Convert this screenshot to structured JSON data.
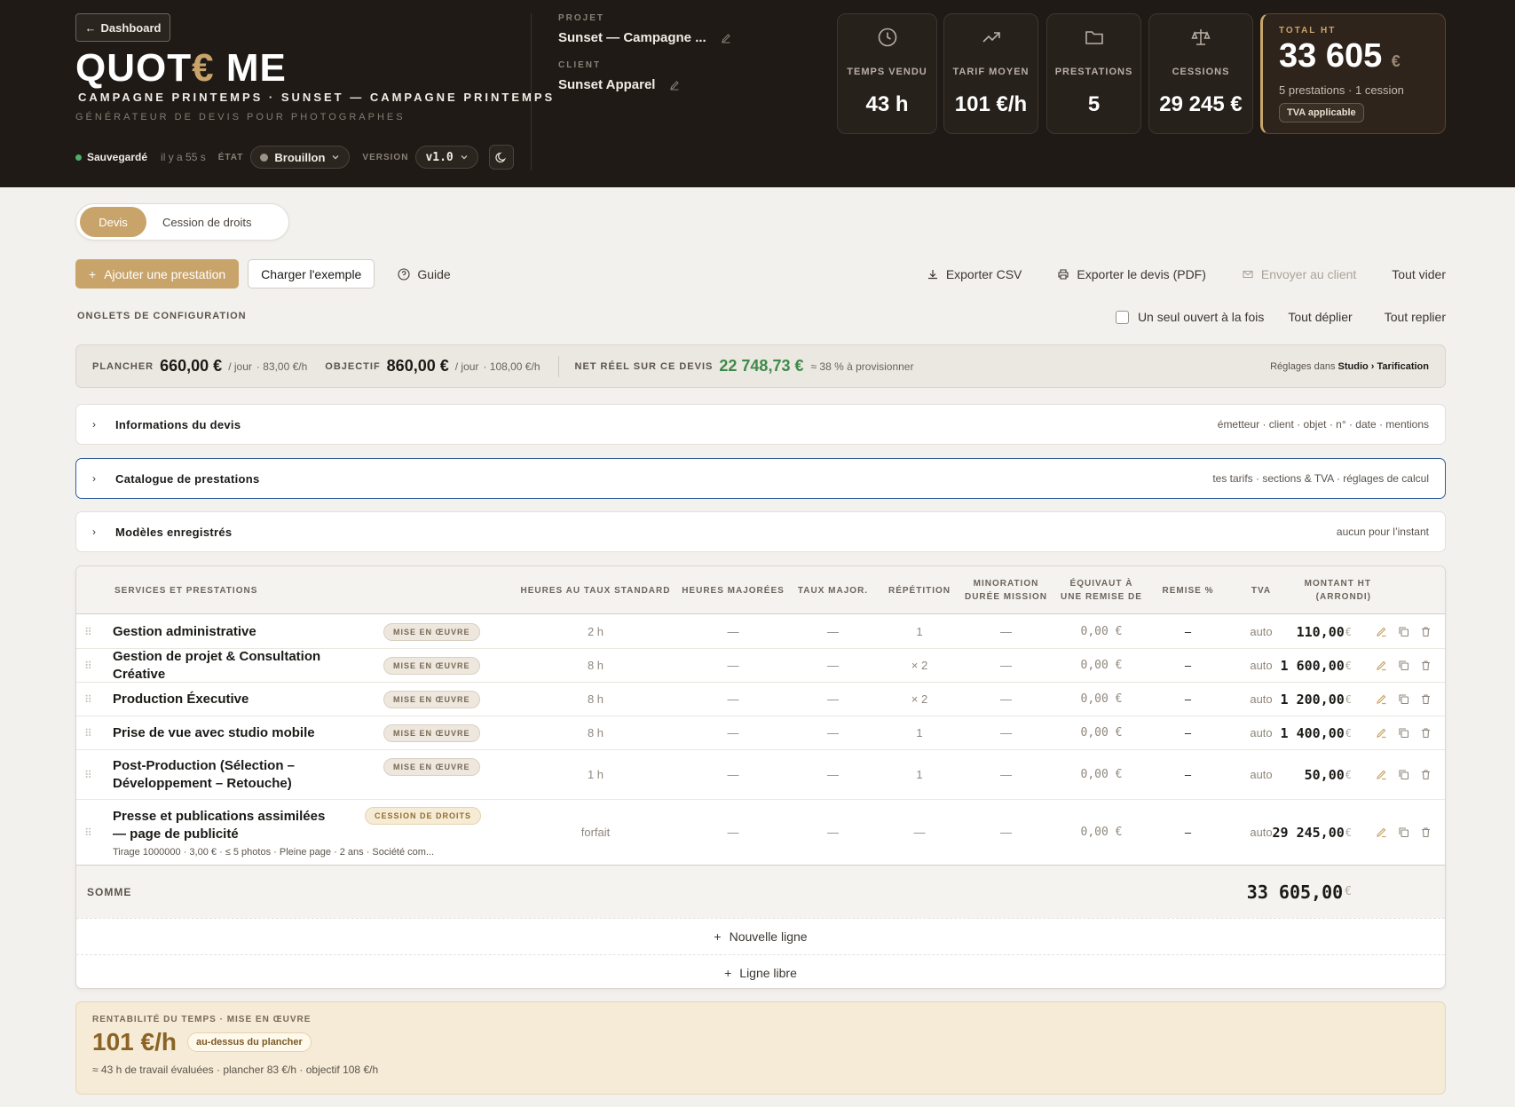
{
  "header": {
    "back_label": "Dashboard",
    "logo_left": "QUOT",
    "logo_euro": "€",
    "logo_right": "ME",
    "subtitle": "CAMPAGNE PRINTEMPS · SUNSET — CAMPAGNE PRINTEMPS",
    "tagline": "GÉNÉRATEUR DE DEVIS POUR PHOTOGRAPHES",
    "saved_label": "Sauvegardé",
    "saved_ago": "il y a 55 s",
    "state_label": "ÉTAT",
    "state_value": "Brouillon",
    "version_label": "VERSION",
    "version_value": "v1.0",
    "project_label": "PROJET",
    "project_value": "Sunset — Campagne ...",
    "client_label": "CLIENT",
    "client_value": "Sunset Apparel"
  },
  "kpis": [
    {
      "label": "TEMPS VENDU",
      "value": "43 h",
      "icon": "clock-icon"
    },
    {
      "label": "TARIF MOYEN",
      "value": "101 €/h",
      "icon": "trending-up-icon"
    },
    {
      "label": "PRESTATIONS",
      "value": "5",
      "icon": "folder-icon"
    },
    {
      "label": "CESSIONS",
      "value": "29 245 €",
      "icon": "scale-icon"
    }
  ],
  "total": {
    "label": "TOTAL HT",
    "value": "33 605",
    "currency": "€",
    "sub": "5 prestations · 1 cession",
    "badge": "TVA applicable"
  },
  "tabs": {
    "devis": "Devis",
    "cession": "Cession de droits"
  },
  "toolbar": {
    "add": "Ajouter une prestation",
    "load_example": "Charger l'exemple",
    "guide": "Guide",
    "export_csv": "Exporter CSV",
    "export_pdf": "Exporter le devis (PDF)",
    "send": "Envoyer au client",
    "clear": "Tout vider"
  },
  "config": {
    "title": "ONGLETS DE CONFIGURATION",
    "single_open": "Un seul ouvert à la fois",
    "expand_all": "Tout déplier",
    "collapse_all": "Tout replier"
  },
  "rates": {
    "floor_label": "PLANCHER",
    "floor_value": "660,00 €",
    "floor_unit": "/ jour",
    "floor_hourly": "· 83,00 €/h",
    "target_label": "OBJECTIF",
    "target_value": "860,00 €",
    "target_unit": "/ jour",
    "target_hourly": "· 108,00 €/h",
    "net_label": "NET RÉEL SUR CE DEVIS",
    "net_value": "22 748,73 €",
    "net_note": "≈ 38 % à provisionner",
    "settings_prefix": "Réglages dans",
    "settings_path": "Studio › Tarification"
  },
  "accordions": [
    {
      "title": "Informations du devis",
      "hint": "émetteur · client · objet · n° · date · mentions"
    },
    {
      "title": "Catalogue de prestations",
      "hint": "tes tarifs · sections & TVA · réglages de calcul"
    },
    {
      "title": "Modèles enregistrés",
      "hint": "aucun pour l’instant"
    }
  ],
  "table": {
    "headers": {
      "service": "SERVICES ET PRESTATIONS",
      "hours": "HEURES AU TAUX STANDARD",
      "hours_major": "HEURES MAJORÉES",
      "rate_major": "TAUX MAJOR.",
      "repetition": "RÉPÉTITION",
      "minoration_1": "MINORATION",
      "minoration_2": "DURÉE MISSION",
      "equiv_1": "ÉQUIVAUT À",
      "equiv_2": "UNE REMISE DE",
      "discount": "REMISE %",
      "tva": "TVA",
      "amount_1": "MONTANT HT",
      "amount_2": "(ARRONDI)"
    },
    "rows": [
      {
        "name": "Gestion administrative",
        "sub": "",
        "badge": "MISE EN ŒUVRE",
        "hours": "2 h",
        "hmaj": "—",
        "tmaj": "—",
        "rep": "1",
        "min": "—",
        "equiv": "0,00 €",
        "disc": "–",
        "tva": "auto",
        "amount": "110,00"
      },
      {
        "name": "Gestion de projet & Consultation Créative",
        "sub": "",
        "badge": "MISE EN ŒUVRE",
        "hours": "8 h",
        "hmaj": "—",
        "tmaj": "—",
        "rep": "× 2",
        "min": "—",
        "equiv": "0,00 €",
        "disc": "–",
        "tva": "auto",
        "amount": "1 600,00"
      },
      {
        "name": "Production Éxecutive",
        "sub": "",
        "badge": "MISE EN ŒUVRE",
        "hours": "8 h",
        "hmaj": "—",
        "tmaj": "—",
        "rep": "× 2",
        "min": "—",
        "equiv": "0,00 €",
        "disc": "–",
        "tva": "auto",
        "amount": "1 200,00"
      },
      {
        "name": "Prise de vue avec studio mobile",
        "sub": "",
        "badge": "MISE EN ŒUVRE",
        "hours": "8 h",
        "hmaj": "—",
        "tmaj": "—",
        "rep": "1",
        "min": "—",
        "equiv": "0,00 €",
        "disc": "–",
        "tva": "auto",
        "amount": "1 400,00"
      },
      {
        "name": "Post-Production (Sélection – Développement – Retouche)",
        "sub": "",
        "badge": "MISE EN ŒUVRE",
        "hours": "1 h",
        "hmaj": "—",
        "tmaj": "—",
        "rep": "1",
        "min": "—",
        "equiv": "0,00 €",
        "disc": "–",
        "tva": "auto",
        "amount": "50,00"
      },
      {
        "name": "Presse et publications assimilées — page de publicité",
        "sub": "Tirage 1000000 · 3,00 € · ≤ 5 photos · Pleine page · 2 ans · Société com...",
        "badge": "CESSION DE DROITS",
        "hours": "forfait",
        "hmaj": "—",
        "tmaj": "—",
        "rep": "—",
        "min": "—",
        "equiv": "0,00 €",
        "disc": "–",
        "tva": "auto",
        "amount": "29 245,00"
      }
    ],
    "currency": "€",
    "sum_label": "SOMME",
    "sum_value": "33 605,00",
    "new_line": "Nouvelle ligne",
    "free_line": "Ligne libre"
  },
  "rentabilite": {
    "label": "RENTABILITÉ DU TEMPS · MISE EN ŒUVRE",
    "value": "101 €/h",
    "badge": "au-dessus du plancher",
    "sub": "≈ 43 h de travail évaluées · plancher 83 €/h · objectif 108 €/h"
  },
  "colors": {
    "accent": "#c9a46a",
    "header_bg": "#1f1a16",
    "positive": "#3f8a4a",
    "focus": "#2e5d9a"
  }
}
